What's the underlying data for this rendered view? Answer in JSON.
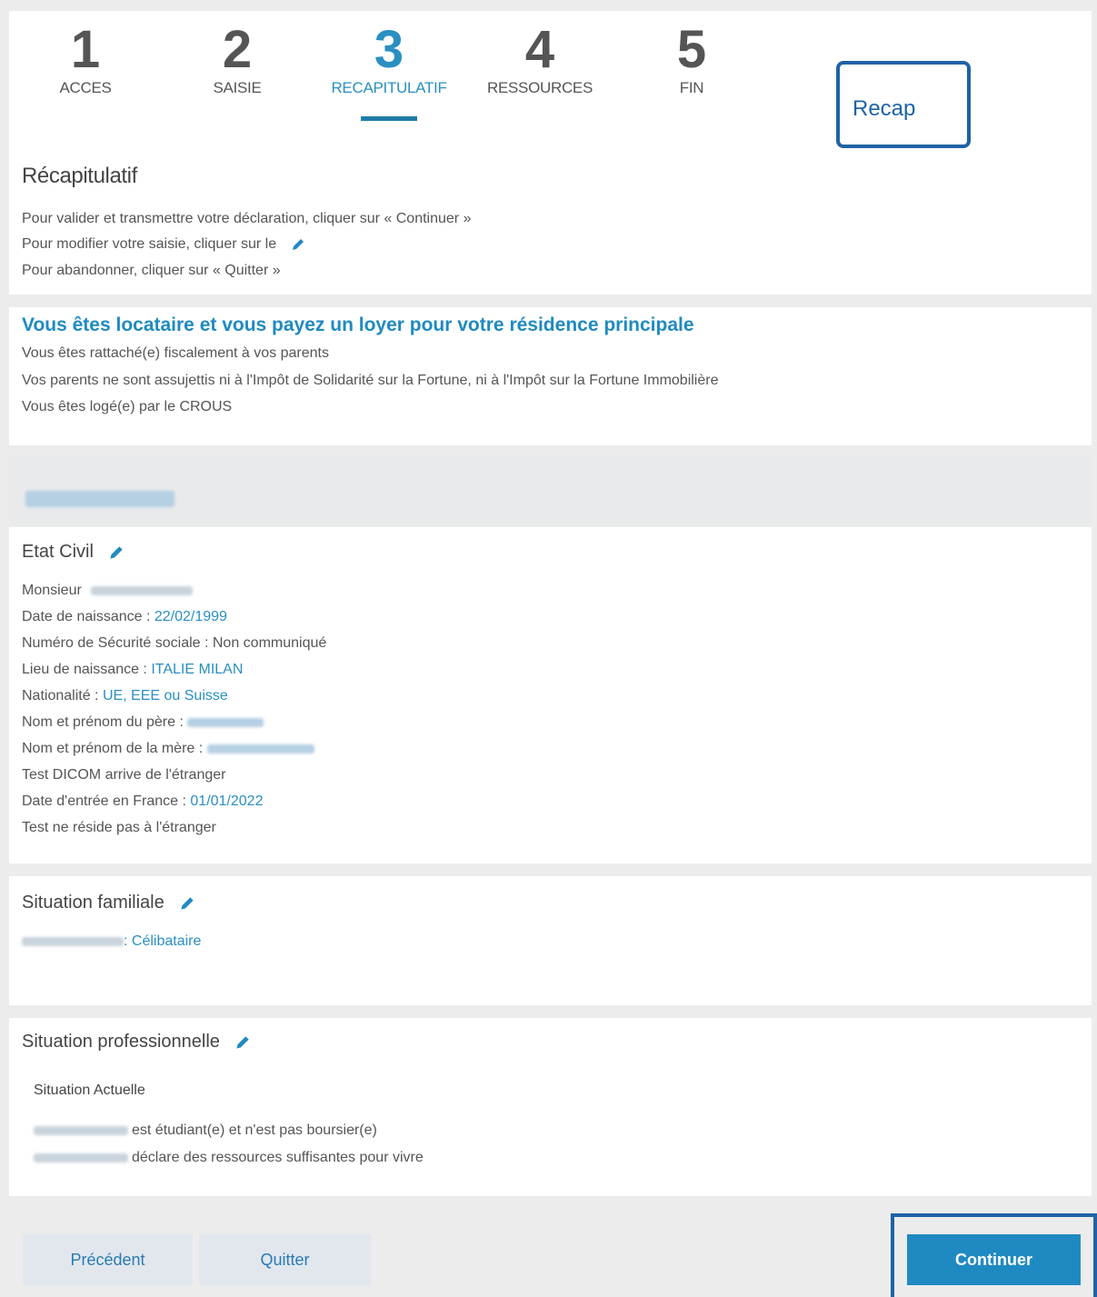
{
  "steps": [
    {
      "number": "1",
      "label": "ACCES"
    },
    {
      "number": "2",
      "label": "SAISIE"
    },
    {
      "number": "3",
      "label": "RECAPITULATIF"
    },
    {
      "number": "4",
      "label": "RESSOURCES"
    },
    {
      "number": "5",
      "label": "FIN"
    }
  ],
  "recap_callout": "Recap",
  "summary": {
    "title": "Récapitulatif",
    "line1": "Pour valider et transmettre votre déclaration, cliquer sur « Continuer »",
    "line2": "Pour modifier votre saisie, cliquer sur le",
    "line3": "Pour abandonner, cliquer sur « Quitter »"
  },
  "housing": {
    "title": "Vous êtes locataire et vous payez un loyer pour votre résidence principale",
    "line1": "Vous êtes rattaché(e) fiscalement à vos parents",
    "line2": "Vos parents ne sont assujettis ni à l'Impôt de Solidarité sur la Fortune, ni à l'Impôt sur la Fortune Immobilière",
    "line3": "Vous êtes logé(e) par le CROUS"
  },
  "etat_civil": {
    "title": "Etat Civil",
    "civility": "Monsieur",
    "birthdate_label": "Date de naissance : ",
    "birthdate": "22/02/1999",
    "ssn": "Numéro de Sécurité sociale : Non communiqué",
    "birthplace_label": "Lieu de naissance : ",
    "birthplace": "ITALIE MILAN",
    "nationality_label": "Nationalité : ",
    "nationality": "UE, EEE ou Suisse",
    "father_label": "Nom et prénom du père : ",
    "mother_label": "Nom et prénom de la mère : ",
    "arrival": "Test DICOM arrive de l'étranger",
    "entry_label": "Date d'entrée en France : ",
    "entry_date": "01/01/2022",
    "residence": "Test ne réside pas à l'étranger"
  },
  "family": {
    "title": "Situation familiale",
    "status": ": Célibataire"
  },
  "professional": {
    "title": "Situation professionnelle",
    "subtitle": "Situation Actuelle",
    "line1": "est étudiant(e) et n'est pas boursier(e)",
    "line2": "déclare des ressources suffisantes pour vivre"
  },
  "buttons": {
    "previous": "Précédent",
    "quit": "Quitter",
    "continue": "Continuer"
  },
  "colors": {
    "accent": "#2a8fc1",
    "callout_border": "#1f63a6"
  }
}
